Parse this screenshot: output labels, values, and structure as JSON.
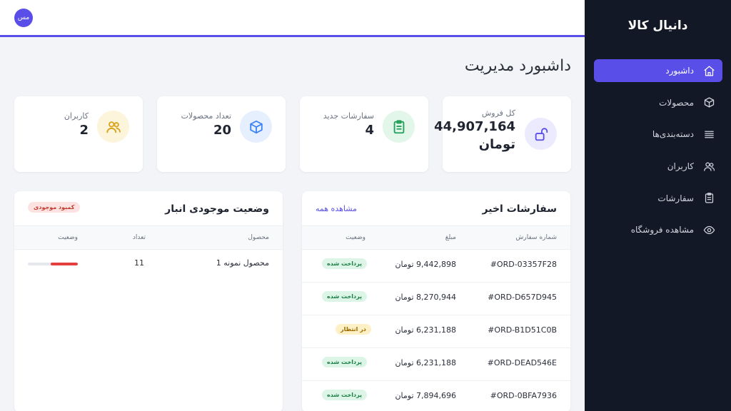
{
  "brand": "دانیال کالا",
  "user": {
    "initials": "مس"
  },
  "nav": [
    {
      "label": "داشبورد",
      "icon": "home-icon",
      "active": true
    },
    {
      "label": "محصولات",
      "icon": "box-icon",
      "active": false
    },
    {
      "label": "دسته‌بندی‌ها",
      "icon": "list-icon",
      "active": false
    },
    {
      "label": "کاربران",
      "icon": "users-icon",
      "active": false
    },
    {
      "label": "سفارشات",
      "icon": "clipboard-icon",
      "active": false
    },
    {
      "label": "مشاهده فروشگاه",
      "icon": "eye-icon",
      "active": false
    }
  ],
  "page_title": "داشبورد مدیریت",
  "stats": {
    "sales": {
      "label": "کل فروش",
      "value": "44,907,164",
      "unit": "تومان",
      "icon": "unlock-icon",
      "color": "#5a4ee8",
      "bg": "#eceafd"
    },
    "orders": {
      "label": "سفارشات جدید",
      "value": "4",
      "icon": "clipboard-check-icon",
      "color": "#22a05a",
      "bg": "#e3f6ea"
    },
    "products": {
      "label": "تعداد محصولات",
      "value": "20",
      "icon": "cube-icon",
      "color": "#3b82f6",
      "bg": "#e5effd"
    },
    "users": {
      "label": "کاربران",
      "value": "2",
      "icon": "users-icon",
      "color": "#d9a21b",
      "bg": "#fdf4dc"
    }
  },
  "orders_panel": {
    "title": "سفارشات اخیر",
    "view_all": "مشاهده همه",
    "columns": {
      "order": "شماره سفارش",
      "amount": "مبلغ",
      "status": "وضعیت"
    },
    "rows": [
      {
        "id": "#ORD-03357F28",
        "amount": "9,442,898 تومان",
        "status": "پرداخت شده",
        "status_type": "paid"
      },
      {
        "id": "#ORD-D657D945",
        "amount": "8,270,944 تومان",
        "status": "پرداخت شده",
        "status_type": "paid"
      },
      {
        "id": "#ORD-B1D51C0B",
        "amount": "6,231,188 تومان",
        "status": "در انتظار",
        "status_type": "pending"
      },
      {
        "id": "#ORD-DEAD546E",
        "amount": "6,231,188 تومان",
        "status": "پرداخت شده",
        "status_type": "paid"
      },
      {
        "id": "#ORD-0BFA7936",
        "amount": "7,894,696 تومان",
        "status": "پرداخت شده",
        "status_type": "paid"
      }
    ]
  },
  "inventory_panel": {
    "title": "وضعیت موجودی انبار",
    "badge": "کمبود موجودی",
    "columns": {
      "product": "محصول",
      "count": "تعداد",
      "status": "وضعیت"
    },
    "rows": [
      {
        "product": "محصول نمونه 1",
        "count": "11",
        "level": 0.55
      }
    ]
  }
}
